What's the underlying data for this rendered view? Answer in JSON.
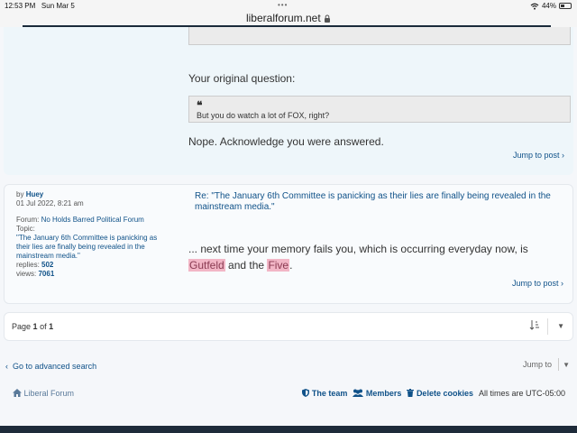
{
  "status_bar": {
    "time": "12:53 PM",
    "date": "Sun Mar 5",
    "dots": "•••",
    "url": "liberalforum.net",
    "lock_icon": "lock-icon",
    "wifi_icon": "wifi-icon",
    "battery_percent": "44%",
    "battery_level": 0.44
  },
  "post1": {
    "label": "Your original question:",
    "quote_mark": "❝",
    "quote_text": "But you do watch a lot of FOX, right?",
    "reply": "Nope.  Acknowledge you were answered.",
    "jump": "Jump to post"
  },
  "post2": {
    "by": "by",
    "author": "Huey",
    "date": "01 Jul 2022, 8:21 am",
    "forum_label": "Forum:",
    "forum": "No Holds Barred Political Forum",
    "topic_label": "Topic:",
    "topic": "\"The January 6th Committee is panicking as their lies are finally being revealed in the mainstream media.\"",
    "replies_label": "replies:",
    "replies": "502",
    "views_label": "views:",
    "views": "7061",
    "title": "Re: \"The January 6th Committee is panicking as their lies are finally being revealed in the mainstream media.\"",
    "body_part1": "... next time your memory fails you, which is occurring everyday now, is",
    "highlight1": "Gutfeld",
    "body_part2": "and the",
    "highlight2": "Five",
    "body_part3": ".",
    "jump": "Jump to post"
  },
  "pagination": {
    "page_label": "Page",
    "current": "1",
    "of_label": "of",
    "total": "1"
  },
  "nav": {
    "advanced_search": "Go to advanced search",
    "jump_to": "Jump to"
  },
  "footer": {
    "site": "Liberal Forum",
    "team": "The team",
    "members": "Members",
    "delete_cookies": "Delete cookies",
    "timezone": "All times are UTC-05:00"
  }
}
